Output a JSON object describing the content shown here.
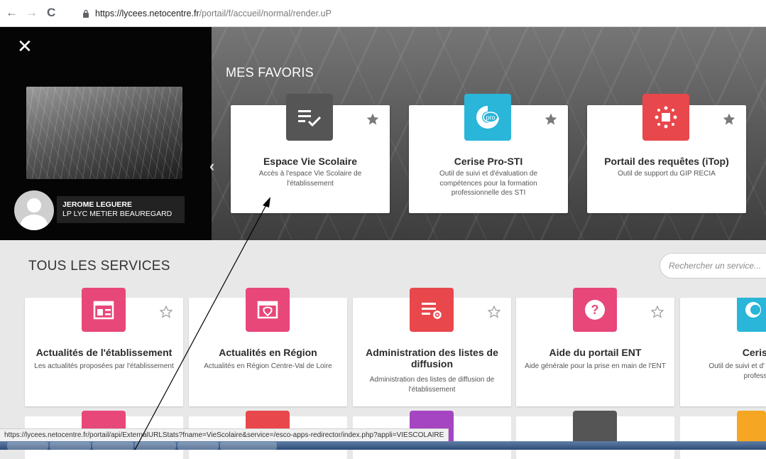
{
  "browser": {
    "back_icon": "←",
    "forward_icon": "→",
    "reload_icon": "C",
    "url_host": "https://lycees.netocentre.fr",
    "url_path": "/portail/f/accueil/normal/render.uP"
  },
  "panel": {
    "close_icon": "✕",
    "user_name": "JEROME LEGUERE",
    "user_school": "LP LYC METIER BEAUREGARD"
  },
  "favorites": {
    "title": "MES FAVORIS",
    "prev_icon": "‹",
    "items": [
      {
        "name": "Espace Vie Scolaire",
        "desc": "Accès à l'espace Vie Scolaire de l'établissement",
        "color": "#555555",
        "icon": "list-check-icon"
      },
      {
        "name": "Cerise Pro-STI",
        "desc": "Outil de suivi et d'évaluation de compétences pour la formation professionnelle des STI",
        "color": "#29b6d9",
        "icon": "cerise-pro-icon"
      },
      {
        "name": "Portail des requêtes (iTop)",
        "desc": "Outil de support du GIP RECIA",
        "color": "#e8474c",
        "icon": "itop-icon"
      }
    ]
  },
  "services": {
    "title": "TOUS LES SERVICES",
    "search_placeholder": "Rechercher un service...",
    "items": [
      {
        "name": "Actualités de l'établissement",
        "desc": "Les actualités proposées par l'établissement",
        "color": "#e8477a"
      },
      {
        "name": "Actualités en Région",
        "desc": "Actualités en Région Centre-Val de Loire",
        "color": "#e8477a"
      },
      {
        "name": "Administration des listes de diffusion",
        "desc": "Administration des listes de diffusion de l'établissement",
        "color": "#e8474c"
      },
      {
        "name": "Aide du portail ENT",
        "desc": "Aide générale pour la prise en main de l'ENT",
        "color": "#e8477a"
      },
      {
        "name": "Cerise Pr",
        "desc": "Outil de suivi et d' compétences pou professionnell",
        "color": "#29b6d9"
      }
    ]
  },
  "status_url": "https://lycees.netocentre.fr/portail/api/ExternalURLStats?fname=VieScolaire&service=/esco-apps-redirector/index.php?appli=VIESCOLAIRE"
}
